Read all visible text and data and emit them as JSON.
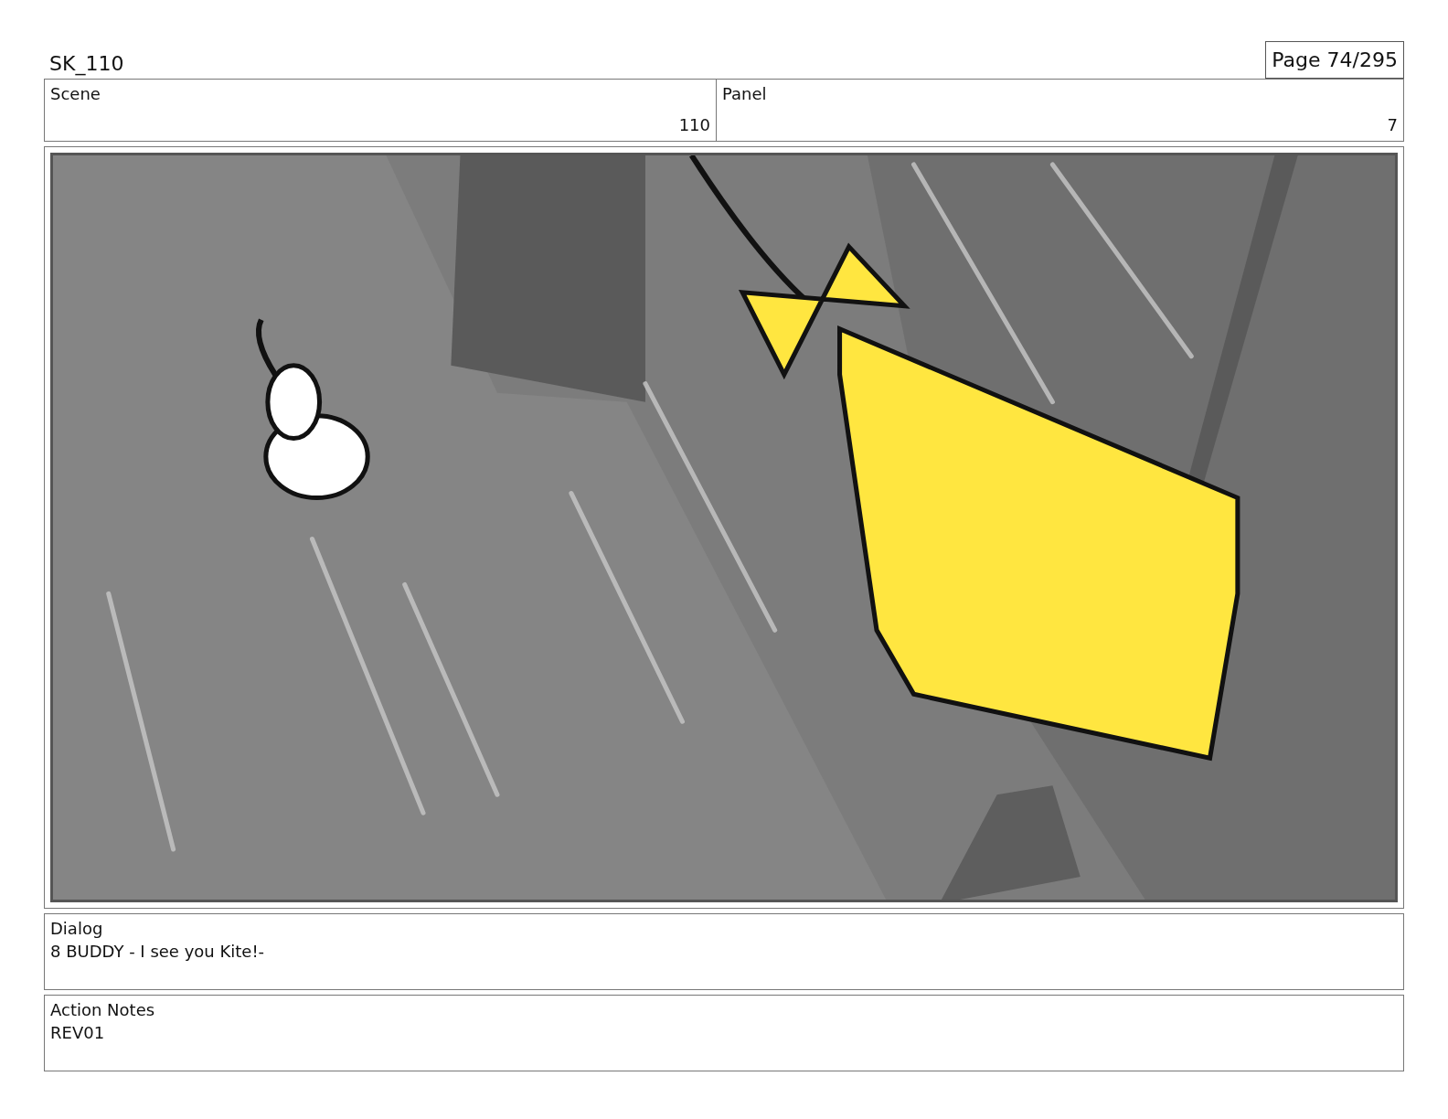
{
  "header": {
    "title": "SK_110",
    "page": "Page 74/295"
  },
  "scene": {
    "label": "Scene",
    "value": "110"
  },
  "panel": {
    "label": "Panel",
    "value": "7"
  },
  "dialog": {
    "label": "Dialog",
    "text": "8 BUDDY - I see you Kite!-"
  },
  "action_notes": {
    "label": "Action Notes",
    "text": "REV01"
  }
}
